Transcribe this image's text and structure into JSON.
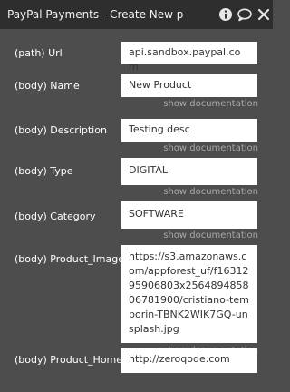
{
  "header": {
    "title": "PayPal Payments - Create New p"
  },
  "fields": [
    {
      "label": "(path) Url",
      "value": "api.sandbox.paypal.com",
      "show_doc": ""
    },
    {
      "label": "(body) Name",
      "value": "New Product",
      "show_doc": "show documentation"
    },
    {
      "label": "(body) Description",
      "value": "Testing desc",
      "show_doc": "show documentation"
    },
    {
      "label": "(body) Type",
      "value": "DIGITAL",
      "show_doc": "show documentation"
    },
    {
      "label": "(body) Category",
      "value": "SOFTWARE",
      "show_doc": "show documentation"
    },
    {
      "label": "(body) Product_Image",
      "value": "https://s3.amazonaws.com/appforest_uf/f1631295906803x256489485806781900/cristiano-temporin-TBNK2WIK7GQ-unsplash.jpg",
      "show_doc": "show documentation"
    },
    {
      "label": "(body) Product_Home",
      "value": "http://zeroqode.com",
      "show_doc": ""
    }
  ],
  "icons": {
    "info": "info-icon",
    "comment": "comment-icon",
    "close": "close-icon"
  },
  "colors": {
    "panel_bg": "#4d4d4d",
    "titlebar_bg": "#2e2e2e",
    "input_bg": "#ffffff",
    "doc_link": "#a9a9a9"
  }
}
